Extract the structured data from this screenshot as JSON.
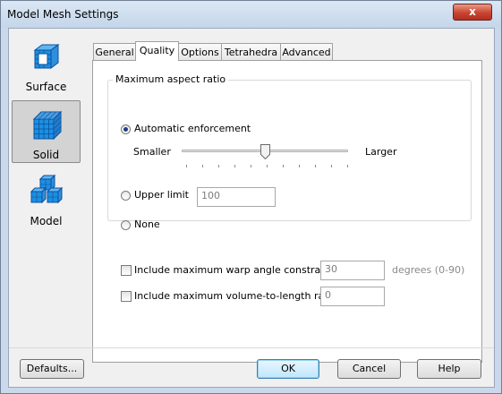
{
  "window": {
    "title": "Model Mesh Settings",
    "close_label": "x"
  },
  "nav": [
    {
      "label": "Surface",
      "icon": "surface-mesh-icon"
    },
    {
      "label": "Solid",
      "icon": "solid-mesh-icon",
      "selected": true
    },
    {
      "label": "Model",
      "icon": "model-cubes-icon"
    }
  ],
  "tabs": [
    "General",
    "Quality",
    "Options",
    "Tetrahedra",
    "Advanced"
  ],
  "selected_tab": "Quality",
  "quality": {
    "group_title": "Maximum aspect ratio",
    "auto_label": "Automatic enforcement",
    "slider_min_label": "Smaller",
    "slider_max_label": "Larger",
    "slider_value": 0.5,
    "upper_label": "Upper limit",
    "upper_value": "100",
    "none_label": "None",
    "selected_option": "Automatic enforcement",
    "warp_label": "Include maximum warp angle constraint",
    "warp_value": "30",
    "warp_unit": "degrees (0-90)",
    "warp_checked": false,
    "volume_label": "Include maximum volume-to-length ratio",
    "volume_value": "0",
    "volume_checked": false
  },
  "buttons": {
    "defaults": "Defaults...",
    "ok": "OK",
    "cancel": "Cancel",
    "help": "Help"
  },
  "colors": {
    "accent_blue": "#1c8fe0",
    "title_bar": "#c9d9eb",
    "close_red": "#c94431"
  }
}
